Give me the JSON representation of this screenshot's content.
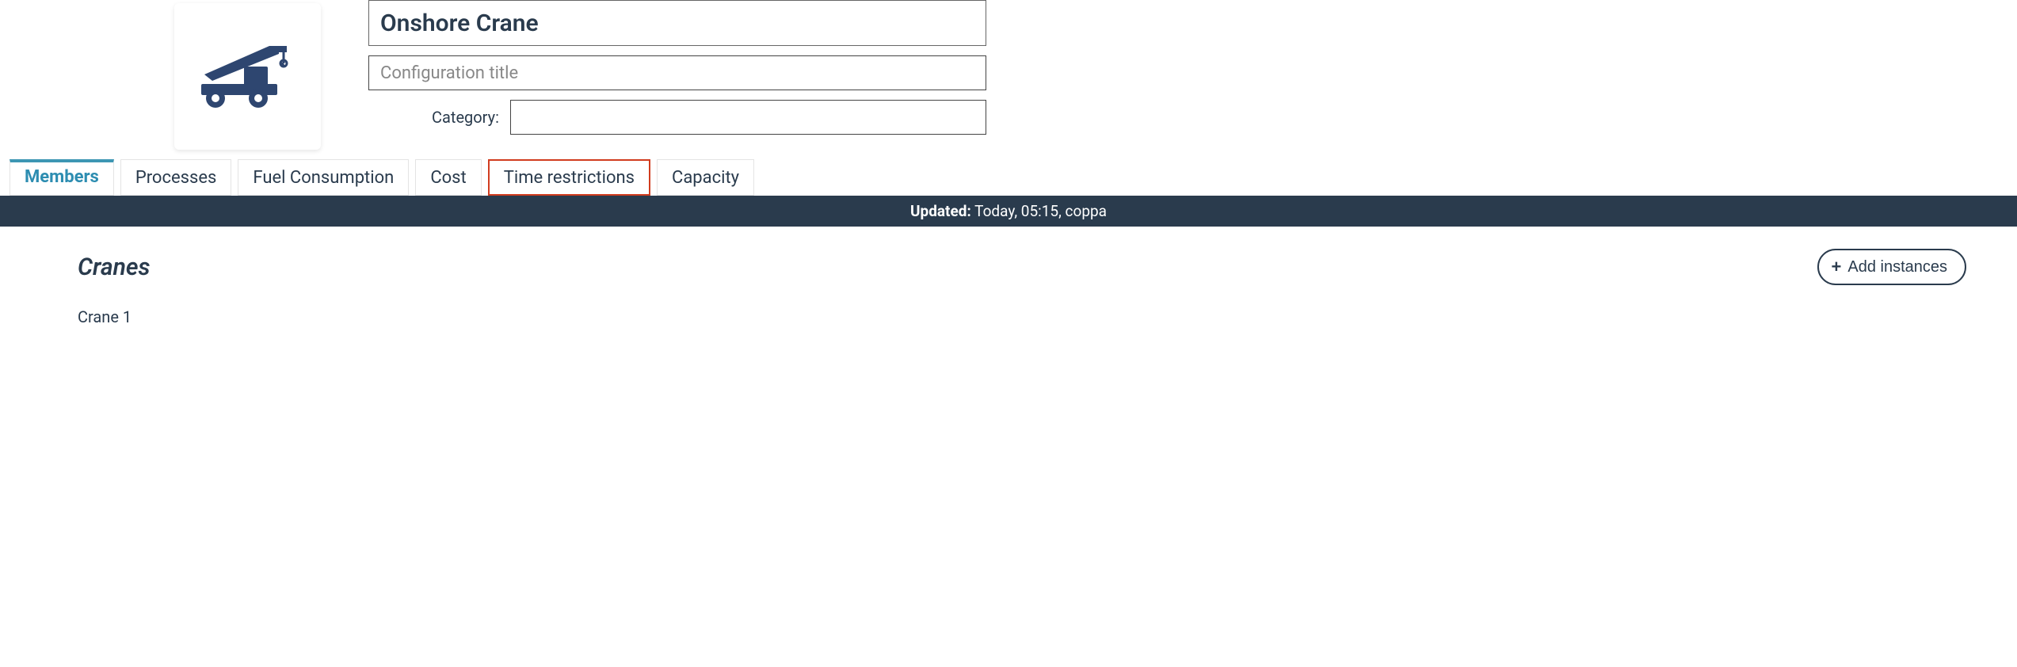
{
  "header": {
    "title_value": "Onshore Crane",
    "config_placeholder": "Configuration title",
    "category_label": "Category:"
  },
  "tabs": [
    {
      "label": "Members",
      "active": true,
      "highlighted": false
    },
    {
      "label": "Processes",
      "active": false,
      "highlighted": false
    },
    {
      "label": "Fuel Consumption",
      "active": false,
      "highlighted": false
    },
    {
      "label": "Cost",
      "active": false,
      "highlighted": false
    },
    {
      "label": "Time restrictions",
      "active": false,
      "highlighted": true
    },
    {
      "label": "Capacity",
      "active": false,
      "highlighted": false
    }
  ],
  "status": {
    "updated_label": "Updated:",
    "updated_value": "Today, 05:15, coppa"
  },
  "section": {
    "title": "Cranes",
    "add_button_label": "Add instances",
    "members": [
      {
        "name": "Crane 1"
      }
    ]
  }
}
